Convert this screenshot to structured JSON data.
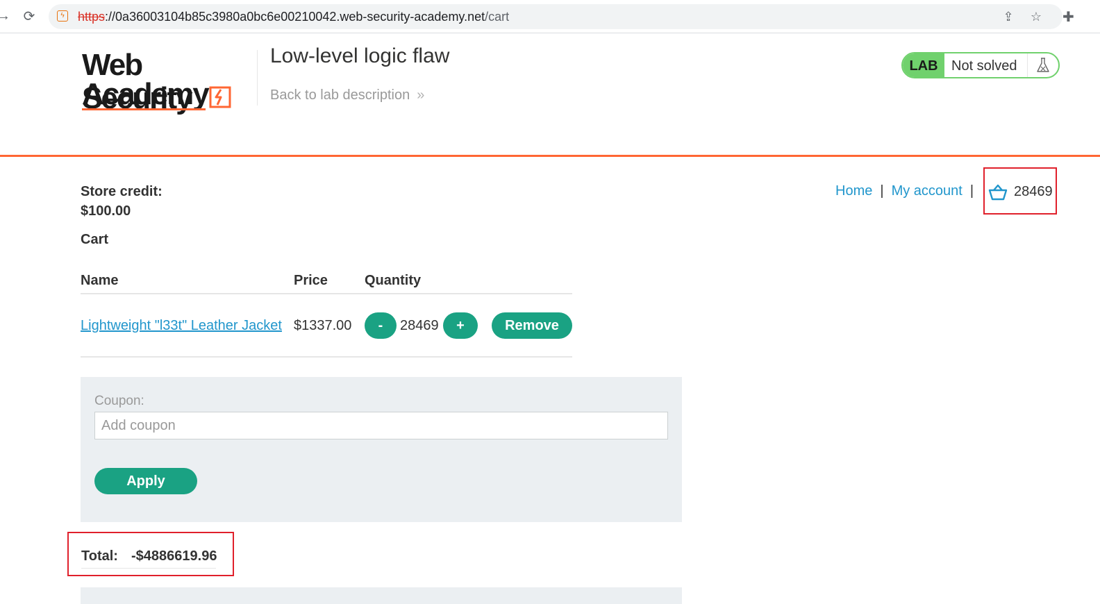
{
  "browser": {
    "url_scheme": "https",
    "url_sep": "://",
    "url_host": "0a36003104b85c3980a0bc6e00210042.web-security-academy.net",
    "url_path": "/cart"
  },
  "header": {
    "logo_line1": "Web Security",
    "logo_line2": "Academy",
    "lab_title": "Low-level logic flaw",
    "back_link": "Back to lab description",
    "back_chevron": "»",
    "lab_badge": "LAB",
    "lab_state": "Not solved"
  },
  "account": {
    "store_credit_label": "Store credit:",
    "store_credit_value": "$100.00"
  },
  "nav": {
    "home": "Home",
    "separator": "|",
    "my_account": "My account",
    "cart_count": "28469"
  },
  "cart": {
    "heading": "Cart",
    "columns": {
      "name": "Name",
      "price": "Price",
      "quantity": "Quantity"
    },
    "items": [
      {
        "name": "Lightweight \"l33t\" Leather Jacket",
        "price": "$1337.00",
        "decrement": "-",
        "quantity": "28469",
        "increment": "+",
        "remove": "Remove"
      }
    ]
  },
  "coupon": {
    "label": "Coupon:",
    "placeholder": "Add coupon",
    "apply": "Apply"
  },
  "total": {
    "label": "Total:",
    "value": "-$4886619.96"
  },
  "colors": {
    "accent": "#ff6633",
    "link": "#2196cc",
    "button": "#1aa283",
    "lab_green": "#70d16d",
    "highlight": "#e0202b"
  },
  "icons": {
    "back": "arrow-right-icon",
    "reload": "reload-icon",
    "site": "site-info-icon",
    "share": "share-icon",
    "bookmark": "star-icon",
    "extensions": "puzzle-icon",
    "flask": "flask-icon",
    "cart": "basket-icon"
  }
}
